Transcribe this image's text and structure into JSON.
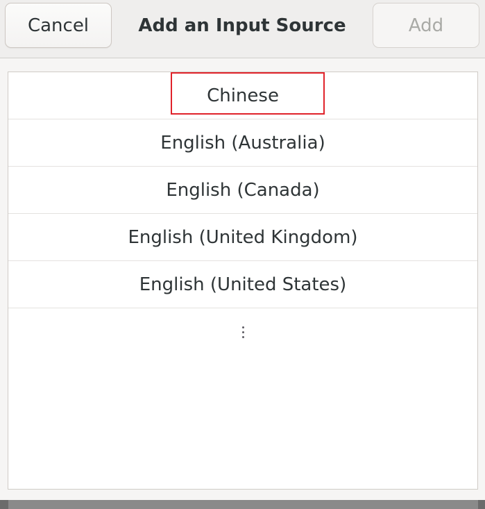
{
  "header": {
    "cancel_label": "Cancel",
    "title": "Add an Input Source",
    "add_label": "Add"
  },
  "list": {
    "items": [
      {
        "label": "Chinese"
      },
      {
        "label": "English (Australia)"
      },
      {
        "label": "English (Canada)"
      },
      {
        "label": "English (United Kingdom)"
      },
      {
        "label": "English (United States)"
      }
    ],
    "more_icon": "more-vertical-icon"
  },
  "colors": {
    "highlight_box": "#e0222a",
    "disabled_text": "#a9aaa6"
  }
}
